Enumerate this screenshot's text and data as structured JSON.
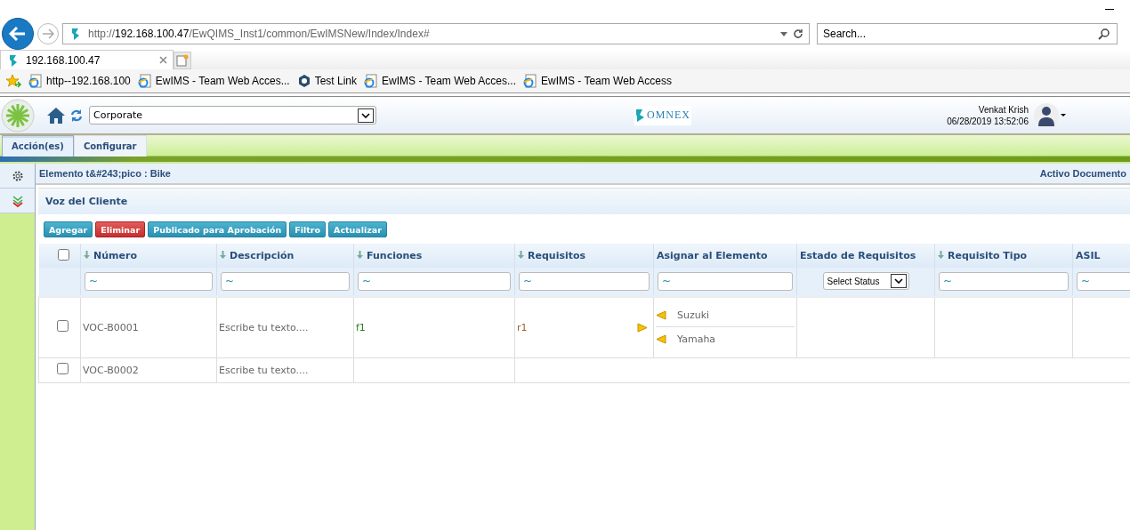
{
  "browser": {
    "url_host": "192.168.100.47",
    "url_prefix": "http://",
    "url_path": "/EwQIMS_Inst1/common/EwIMSNew/Index/Index#",
    "search": {
      "placeholder": "Search..."
    },
    "tab": {
      "title": "192.168.100.47"
    },
    "favorites": [
      {
        "label": "http--192.168.100",
        "kind": "ie"
      },
      {
        "label": "EwIMS - Team Web Acces...",
        "kind": "ie"
      },
      {
        "label": "Test Link",
        "kind": "hex"
      },
      {
        "label": "EwIMS - Team Web Acces...",
        "kind": "ie"
      },
      {
        "label": "EwIMS - Team Web Access",
        "kind": "ie"
      }
    ]
  },
  "header": {
    "organization": "Corporate",
    "user": "Venkat Krish",
    "datetime": "06/28/2019 13:52:06",
    "logo": "OMNEX"
  },
  "menu": [
    {
      "label": "Acción(es)",
      "selected": true
    },
    {
      "label": "Configurar",
      "selected": false
    }
  ],
  "breadcrumb": "Elemento t&#243;pico : Bike",
  "status": "Activo Documento",
  "panel_title": "Voz del Cliente",
  "buttons": [
    {
      "label": "Agregar",
      "kind": "primary"
    },
    {
      "label": "Eliminar",
      "kind": "danger"
    },
    {
      "label": "Publicado para Aprobación",
      "kind": "primary"
    },
    {
      "label": "Filtro",
      "kind": "primary"
    },
    {
      "label": "Actualizar",
      "kind": "primary"
    }
  ],
  "table": {
    "select_all": false,
    "columns": [
      {
        "label": "Número",
        "sortable": true,
        "filter": {
          "kind": "text",
          "value": "~"
        }
      },
      {
        "label": "Descripción",
        "sortable": true,
        "filter": {
          "kind": "text",
          "value": "~"
        }
      },
      {
        "label": "Funciones",
        "sortable": true,
        "filter": {
          "kind": "text",
          "value": "~"
        }
      },
      {
        "label": "Requisitos",
        "sortable": true,
        "filter": {
          "kind": "text",
          "value": "~"
        }
      },
      {
        "label": "Asignar al Elemento",
        "sortable": false,
        "filter": {
          "kind": "text",
          "value": "~"
        }
      },
      {
        "label": "Estado de Requisitos",
        "sortable": false,
        "filter": {
          "kind": "select",
          "value": "Select Status"
        }
      },
      {
        "label": "Requisito Tipo",
        "sortable": true,
        "filter": {
          "kind": "text",
          "value": "~"
        }
      },
      {
        "label": "ASIL",
        "sortable": false,
        "filter": {
          "kind": "text",
          "value": "~"
        }
      }
    ],
    "rows": [
      {
        "checked": false,
        "number": "VOC-B0001",
        "description": "Escribe tu texto....",
        "function": "f1",
        "requirement": "r1",
        "assigned": [
          "Suzuki",
          "Yamaha"
        ]
      },
      {
        "checked": false,
        "number": "VOC-B0002",
        "description": "Escribe tu texto...."
      }
    ]
  }
}
